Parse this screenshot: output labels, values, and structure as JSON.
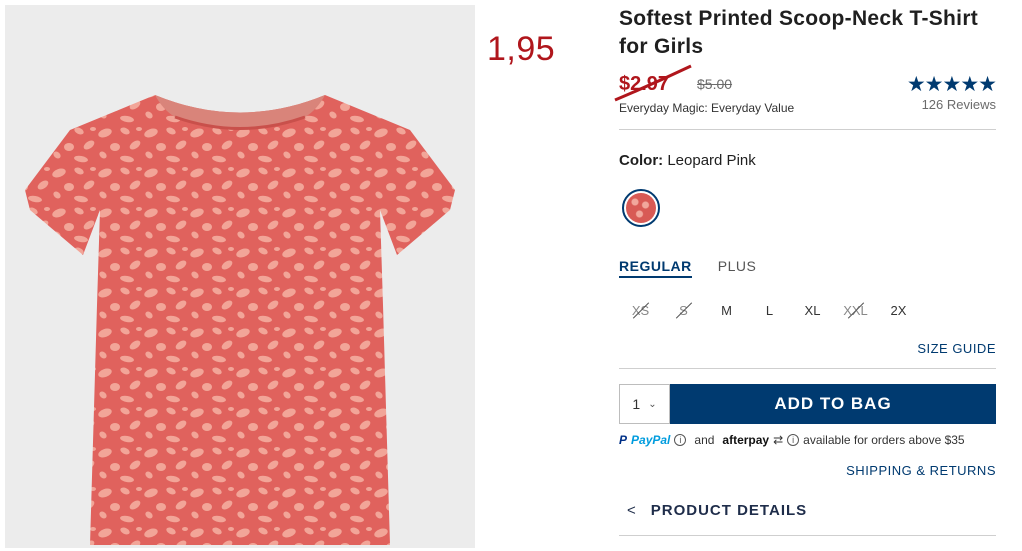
{
  "overlay_price": "1,95",
  "product": {
    "title": "Softest Printed Scoop-Neck T-Shirt for Girls",
    "sale_price": "$2.97",
    "original_price": "$5.00",
    "promo": "Everyday Magic: Everyday Value",
    "rating_stars": "★★★★★",
    "reviews": "126 Reviews"
  },
  "color": {
    "label": "Color:",
    "value": "Leopard Pink",
    "swatch_color": "#d85a55"
  },
  "fit_tabs": [
    {
      "label": "REGULAR",
      "active": true
    },
    {
      "label": "PLUS",
      "active": false
    }
  ],
  "sizes": [
    {
      "label": "XS",
      "available": false
    },
    {
      "label": "S",
      "available": false
    },
    {
      "label": "M",
      "available": true
    },
    {
      "label": "L",
      "available": true
    },
    {
      "label": "XL",
      "available": true
    },
    {
      "label": "XXL",
      "available": false
    },
    {
      "label": "2X",
      "available": true
    }
  ],
  "size_guide": "SIZE GUIDE",
  "quantity": "1",
  "add_to_bag": "ADD TO BAG",
  "payment": {
    "paypal": "PayPal",
    "and": "and",
    "afterpay": "afterpay",
    "note": "available for orders above $35"
  },
  "shipping_returns": "SHIPPING & RETURNS",
  "product_details": "PRODUCT DETAILS",
  "colors": {
    "accent": "#003a70",
    "sale": "#b0161c",
    "shirt": "#e0625d",
    "spots": "#f2a598"
  }
}
